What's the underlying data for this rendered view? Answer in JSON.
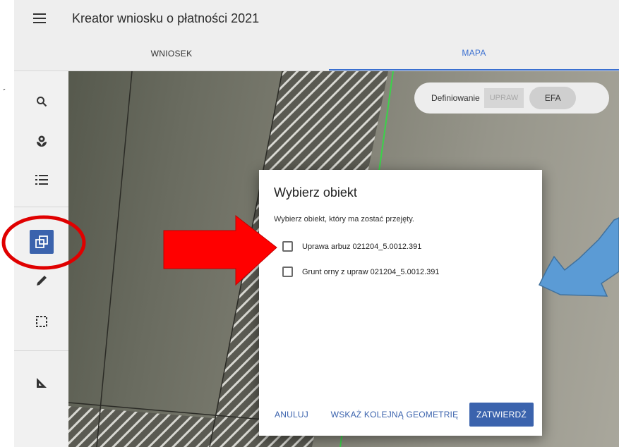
{
  "header": {
    "title": "Kreator wniosku o płatności 2021",
    "menu_icon": "menu-icon"
  },
  "tabs": [
    {
      "label": "WNIOSEK",
      "active": false
    },
    {
      "label": "MAPA",
      "active": true
    }
  ],
  "toolbar": {
    "tools": [
      {
        "icon": "search-icon",
        "active": false
      },
      {
        "icon": "crop-plant-icon",
        "active": false
      },
      {
        "icon": "list-icon",
        "active": false
      },
      {
        "icon": "copy-geometry-icon",
        "active": true
      },
      {
        "icon": "pencil-icon",
        "active": false
      },
      {
        "icon": "select-area-icon",
        "active": false
      },
      {
        "icon": "measure-icon",
        "active": false
      }
    ]
  },
  "map": {
    "definition_label": "Definiowanie",
    "definition_options": [
      "UPRAW",
      "EFA"
    ]
  },
  "dialog": {
    "title": "Wybierz obiekt",
    "description": "Wybierz obiekt, który ma zostać przejęty.",
    "options": [
      {
        "label": "Uprawa arbuz 021204_5.0012.391",
        "checked": false
      },
      {
        "label": "Grunt orny z upraw 021204_5.0012.391",
        "checked": false
      }
    ],
    "buttons": {
      "cancel": "ANULUJ",
      "next_geometry": "WSKAŻ KOLEJNĄ GEOMETRIĘ",
      "confirm": "ZATWIERDŹ"
    }
  },
  "colors": {
    "accent": "#3b63ad",
    "annotation_red": "#e00000",
    "annotation_blue": "#5b9bd5"
  }
}
